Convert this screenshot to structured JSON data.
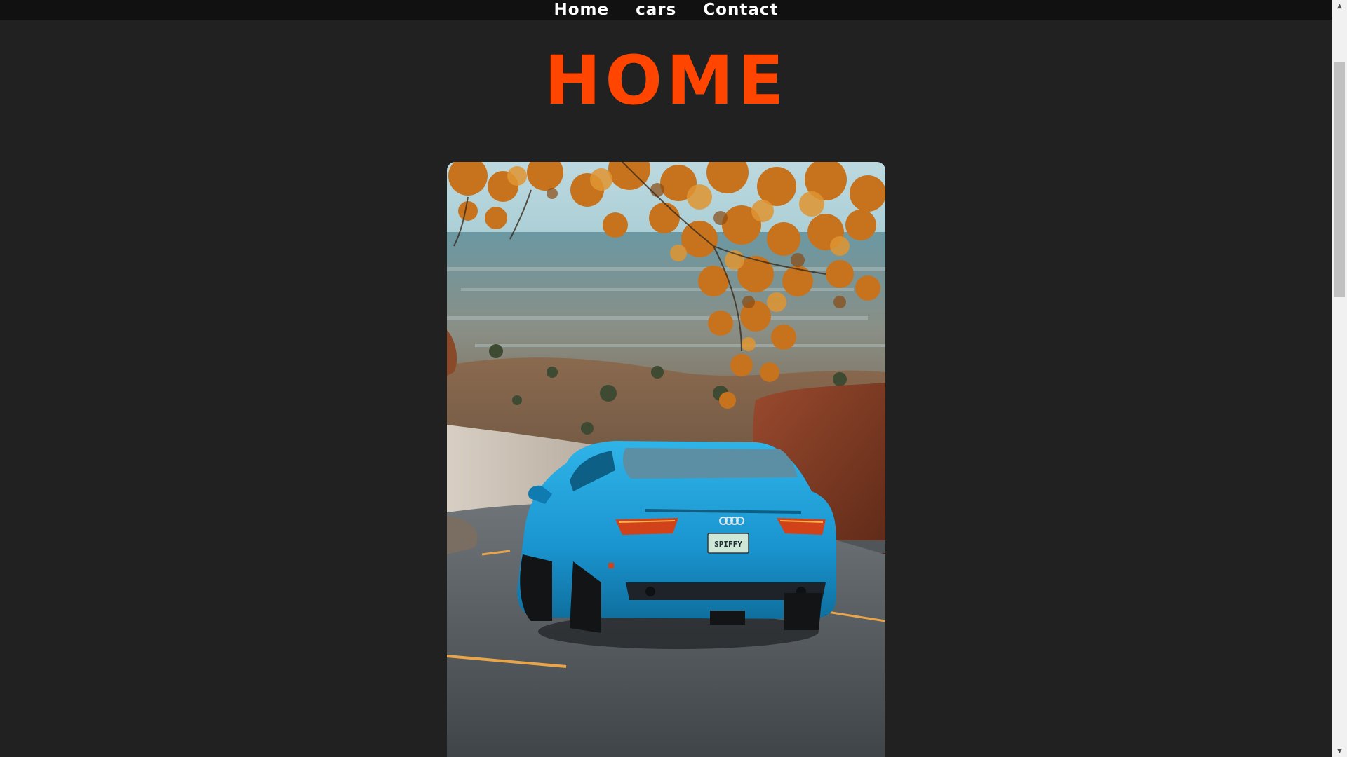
{
  "nav": {
    "items": [
      {
        "label": "Home"
      },
      {
        "label": "cars"
      },
      {
        "label": "Contact"
      }
    ]
  },
  "main": {
    "title": "HOME",
    "hero_image": {
      "alt": "",
      "plate_text": "SPIFFY"
    }
  },
  "colors": {
    "background": "#212121",
    "nav_background": "#111111",
    "title_accent": "#ff4500",
    "nav_text": "#ffffff"
  },
  "scrollbar": {
    "up_icon": "chevron-up-icon",
    "down_icon": "chevron-down-icon"
  }
}
